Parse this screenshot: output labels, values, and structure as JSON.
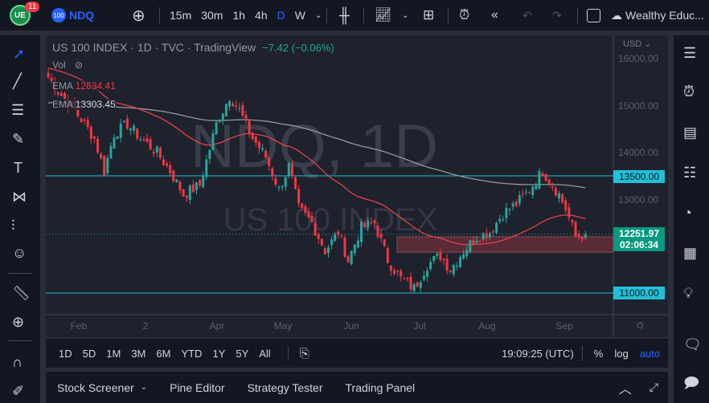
{
  "topbar": {
    "notif_count": "11",
    "symbol_badge": "100",
    "symbol": "NDQ",
    "intervals": [
      "15m",
      "30m",
      "1h",
      "4h",
      "D",
      "W"
    ],
    "active_interval": "D",
    "account": "Wealthy Educ..."
  },
  "legend": {
    "title": "US 100 INDEX · 1D · TVC · TradingView",
    "change": "−7.42 (−0.06%)",
    "vol": "Vol",
    "ema1_label": "EMA",
    "ema1_value": "12634.41",
    "ema2_label": "EMA",
    "ema2_value": "13303.45"
  },
  "watermark": {
    "symbol": "NDQ, 1D",
    "name": "US 100 INDEX"
  },
  "price_axis": {
    "currency": "USD",
    "ticks": [
      "16000.00",
      "15000.00",
      "14000.00",
      "13000.00"
    ],
    "level_13500": "13500.00",
    "level_11000": "11000.00",
    "last_price": "12251.97",
    "countdown": "02:06:34"
  },
  "time_axis": [
    "Feb",
    "2",
    "Apr",
    "May",
    "Jun",
    "Jul",
    "Aug",
    "Sep"
  ],
  "bottom": {
    "ranges": [
      "1D",
      "5D",
      "1M",
      "3M",
      "6M",
      "YTD",
      "1Y",
      "5Y",
      "All"
    ],
    "clock": "19:09:25 (UTC)",
    "percent": "%",
    "log": "log",
    "auto": "auto"
  },
  "tabs": [
    "Stock Screener",
    "Pine Editor",
    "Strategy Tester",
    "Trading Panel"
  ],
  "colors": {
    "up": "#26a69a",
    "down": "#f23645",
    "ema_fast": "#e2434f",
    "ema_slow": "#9598a1",
    "hline": "#22c0d6",
    "zone": "#6e2f3a",
    "accent": "#2962ff"
  },
  "chart_data": {
    "type": "candlestick",
    "keypoints": [
      [
        0,
        15600
      ],
      [
        3,
        15300
      ],
      [
        8,
        14900
      ],
      [
        14,
        14300
      ],
      [
        17,
        13600
      ],
      [
        20,
        14400
      ],
      [
        24,
        14600
      ],
      [
        28,
        14300
      ],
      [
        33,
        14000
      ],
      [
        37,
        13600
      ],
      [
        41,
        13100
      ],
      [
        46,
        13300
      ],
      [
        51,
        14600
      ],
      [
        55,
        15200
      ],
      [
        58,
        14900
      ],
      [
        62,
        14300
      ],
      [
        66,
        13900
      ],
      [
        70,
        13200
      ],
      [
        73,
        13700
      ],
      [
        76,
        12800
      ],
      [
        80,
        12500
      ],
      [
        84,
        11900
      ],
      [
        88,
        12300
      ],
      [
        91,
        11700
      ],
      [
        95,
        12400
      ],
      [
        99,
        12500
      ],
      [
        103,
        11700
      ],
      [
        107,
        11300
      ],
      [
        111,
        11100
      ],
      [
        115,
        11600
      ],
      [
        119,
        11800
      ],
      [
        122,
        11500
      ],
      [
        126,
        11900
      ],
      [
        130,
        12200
      ],
      [
        134,
        12300
      ],
      [
        138,
        12700
      ],
      [
        142,
        12900
      ],
      [
        146,
        13200
      ],
      [
        150,
        13600
      ],
      [
        152,
        13400
      ],
      [
        155,
        13100
      ],
      [
        157,
        12800
      ],
      [
        160,
        12200
      ],
      [
        163,
        12260
      ]
    ],
    "ema_fast_start": 15800,
    "ema_slow_start": 15050,
    "zone": [
      11870,
      12200
    ],
    "levels": [
      13500,
      11000
    ],
    "last": 12251.97
  }
}
